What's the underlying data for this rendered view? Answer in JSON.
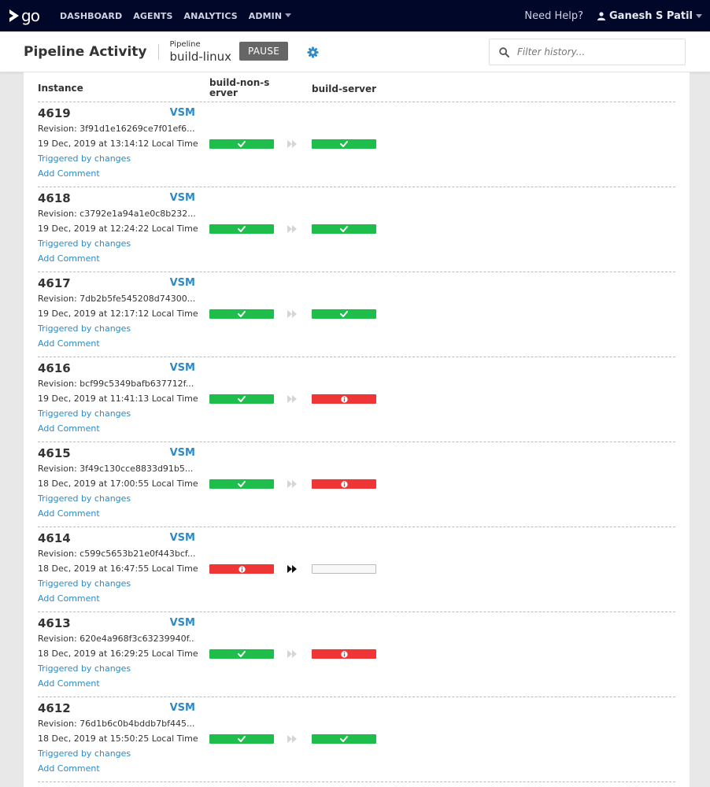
{
  "nav": {
    "logo_text": "go",
    "items": [
      {
        "label": "DASHBOARD"
      },
      {
        "label": "AGENTS"
      },
      {
        "label": "ANALYTICS"
      },
      {
        "label": "ADMIN"
      }
    ],
    "help": "Need Help?",
    "user": "Ganesh S Patil"
  },
  "header": {
    "title": "Pipeline Activity",
    "pipeline_label": "Pipeline",
    "pipeline_name": "build-linux",
    "pause_label": "PAUSE",
    "search_placeholder": "Filter history..."
  },
  "table": {
    "col_instance": "Instance",
    "col_stage1": "build-non-server",
    "col_stage2": "build-server",
    "vsm_label": "VSM",
    "triggered_label": "Triggered by changes",
    "comment_label": "Add Comment"
  },
  "colors": {
    "passed": "#1fbd4b",
    "failed": "#ef3636",
    "link": "#2e8ac4",
    "nav_bg": "#000728"
  },
  "rows": [
    {
      "instance": "4619",
      "revision": "Revision: 3f91d1e16269ce7f01ef6...",
      "date": "19 Dec, 2019 at 13:14:12 Local Time",
      "stage1": "passed",
      "stage2": "passed",
      "arrow_active": false
    },
    {
      "instance": "4618",
      "revision": "Revision: c3792e1a94a1e0c8b232...",
      "date": "19 Dec, 2019 at 12:24:22 Local Time",
      "stage1": "passed",
      "stage2": "passed",
      "arrow_active": false
    },
    {
      "instance": "4617",
      "revision": "Revision: 7db2b5fe545208d74300...",
      "date": "19 Dec, 2019 at 12:17:12 Local Time",
      "stage1": "passed",
      "stage2": "passed",
      "arrow_active": false
    },
    {
      "instance": "4616",
      "revision": "Revision: bcf99c5349bafb637712f...",
      "date": "19 Dec, 2019 at 11:41:13 Local Time",
      "stage1": "passed",
      "stage2": "failed",
      "arrow_active": false
    },
    {
      "instance": "4615",
      "revision": "Revision: 3f49c130cce8833d91b5...",
      "date": "18 Dec, 2019 at 17:00:55 Local Time",
      "stage1": "passed",
      "stage2": "failed",
      "arrow_active": false
    },
    {
      "instance": "4614",
      "revision": "Revision: c599c5653b21e0f443bcf...",
      "date": "18 Dec, 2019 at 16:47:55 Local Time",
      "stage1": "failed",
      "stage2": "unknown",
      "arrow_active": true
    },
    {
      "instance": "4613",
      "revision": "Revision: 620e4a968f3c63239940f...",
      "date": "18 Dec, 2019 at 16:29:25 Local Time",
      "stage1": "passed",
      "stage2": "failed",
      "arrow_active": false
    },
    {
      "instance": "4612",
      "revision": "Revision: 76d1b6c0b4bddb7bf445...",
      "date": "18 Dec, 2019 at 15:50:25 Local Time",
      "stage1": "passed",
      "stage2": "passed",
      "arrow_active": false
    }
  ]
}
